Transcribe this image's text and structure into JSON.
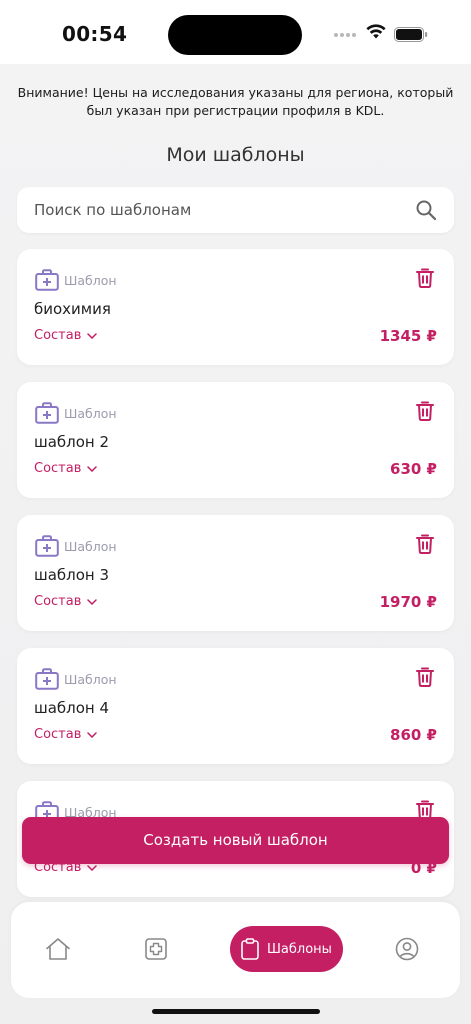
{
  "status_bar": {
    "time": "00:54"
  },
  "notice": "Внимание! Цены на исследования указаны для региона, который был указан при регистрации профиля в KDL.",
  "page_title": "Мои шаблоны",
  "search": {
    "placeholder": "Поиск по шаблонам",
    "value": ""
  },
  "templates": [
    {
      "type_label": "Шаблон",
      "name": "биохимия",
      "toggle_label": "Состав",
      "price": "1345 ₽"
    },
    {
      "type_label": "Шаблон",
      "name": "шаблон 2",
      "toggle_label": "Состав",
      "price": "630 ₽"
    },
    {
      "type_label": "Шаблон",
      "name": "шаблон 3",
      "toggle_label": "Состав",
      "price": "1970 ₽"
    },
    {
      "type_label": "Шаблон",
      "name": "шаблон 4",
      "toggle_label": "Состав",
      "price": "860 ₽"
    },
    {
      "type_label": "Шаблон",
      "name": "",
      "toggle_label": "Состав",
      "price": "0 ₽"
    }
  ],
  "create_button": "Создать новый шаблон",
  "bottom_nav": {
    "items": [
      {
        "icon": "home-icon",
        "label": ""
      },
      {
        "icon": "medical-plus-icon",
        "label": ""
      },
      {
        "icon": "clipboard-icon",
        "label": "Шаблоны",
        "active": true
      },
      {
        "icon": "profile-icon",
        "label": ""
      }
    ]
  },
  "colors": {
    "accent": "#c41f63",
    "type_icon": "#8a78c6",
    "muted": "#9c9cae"
  }
}
